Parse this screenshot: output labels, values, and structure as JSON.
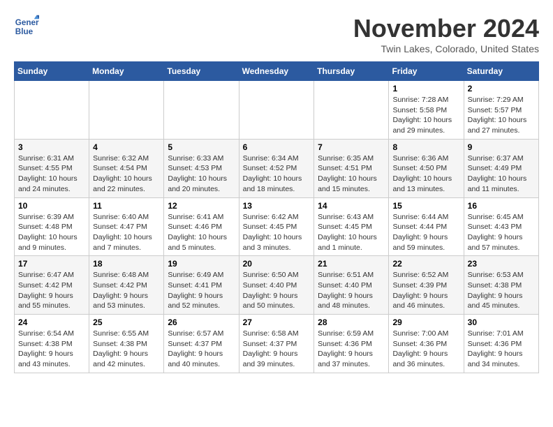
{
  "logo": {
    "line1": "General",
    "line2": "Blue"
  },
  "title": "November 2024",
  "location": "Twin Lakes, Colorado, United States",
  "weekdays": [
    "Sunday",
    "Monday",
    "Tuesday",
    "Wednesday",
    "Thursday",
    "Friday",
    "Saturday"
  ],
  "weeks": [
    [
      {
        "day": "",
        "info": ""
      },
      {
        "day": "",
        "info": ""
      },
      {
        "day": "",
        "info": ""
      },
      {
        "day": "",
        "info": ""
      },
      {
        "day": "",
        "info": ""
      },
      {
        "day": "1",
        "info": "Sunrise: 7:28 AM\nSunset: 5:58 PM\nDaylight: 10 hours and 29 minutes."
      },
      {
        "day": "2",
        "info": "Sunrise: 7:29 AM\nSunset: 5:57 PM\nDaylight: 10 hours and 27 minutes."
      }
    ],
    [
      {
        "day": "3",
        "info": "Sunrise: 6:31 AM\nSunset: 4:55 PM\nDaylight: 10 hours and 24 minutes."
      },
      {
        "day": "4",
        "info": "Sunrise: 6:32 AM\nSunset: 4:54 PM\nDaylight: 10 hours and 22 minutes."
      },
      {
        "day": "5",
        "info": "Sunrise: 6:33 AM\nSunset: 4:53 PM\nDaylight: 10 hours and 20 minutes."
      },
      {
        "day": "6",
        "info": "Sunrise: 6:34 AM\nSunset: 4:52 PM\nDaylight: 10 hours and 18 minutes."
      },
      {
        "day": "7",
        "info": "Sunrise: 6:35 AM\nSunset: 4:51 PM\nDaylight: 10 hours and 15 minutes."
      },
      {
        "day": "8",
        "info": "Sunrise: 6:36 AM\nSunset: 4:50 PM\nDaylight: 10 hours and 13 minutes."
      },
      {
        "day": "9",
        "info": "Sunrise: 6:37 AM\nSunset: 4:49 PM\nDaylight: 10 hours and 11 minutes."
      }
    ],
    [
      {
        "day": "10",
        "info": "Sunrise: 6:39 AM\nSunset: 4:48 PM\nDaylight: 10 hours and 9 minutes."
      },
      {
        "day": "11",
        "info": "Sunrise: 6:40 AM\nSunset: 4:47 PM\nDaylight: 10 hours and 7 minutes."
      },
      {
        "day": "12",
        "info": "Sunrise: 6:41 AM\nSunset: 4:46 PM\nDaylight: 10 hours and 5 minutes."
      },
      {
        "day": "13",
        "info": "Sunrise: 6:42 AM\nSunset: 4:45 PM\nDaylight: 10 hours and 3 minutes."
      },
      {
        "day": "14",
        "info": "Sunrise: 6:43 AM\nSunset: 4:45 PM\nDaylight: 10 hours and 1 minute."
      },
      {
        "day": "15",
        "info": "Sunrise: 6:44 AM\nSunset: 4:44 PM\nDaylight: 9 hours and 59 minutes."
      },
      {
        "day": "16",
        "info": "Sunrise: 6:45 AM\nSunset: 4:43 PM\nDaylight: 9 hours and 57 minutes."
      }
    ],
    [
      {
        "day": "17",
        "info": "Sunrise: 6:47 AM\nSunset: 4:42 PM\nDaylight: 9 hours and 55 minutes."
      },
      {
        "day": "18",
        "info": "Sunrise: 6:48 AM\nSunset: 4:42 PM\nDaylight: 9 hours and 53 minutes."
      },
      {
        "day": "19",
        "info": "Sunrise: 6:49 AM\nSunset: 4:41 PM\nDaylight: 9 hours and 52 minutes."
      },
      {
        "day": "20",
        "info": "Sunrise: 6:50 AM\nSunset: 4:40 PM\nDaylight: 9 hours and 50 minutes."
      },
      {
        "day": "21",
        "info": "Sunrise: 6:51 AM\nSunset: 4:40 PM\nDaylight: 9 hours and 48 minutes."
      },
      {
        "day": "22",
        "info": "Sunrise: 6:52 AM\nSunset: 4:39 PM\nDaylight: 9 hours and 46 minutes."
      },
      {
        "day": "23",
        "info": "Sunrise: 6:53 AM\nSunset: 4:38 PM\nDaylight: 9 hours and 45 minutes."
      }
    ],
    [
      {
        "day": "24",
        "info": "Sunrise: 6:54 AM\nSunset: 4:38 PM\nDaylight: 9 hours and 43 minutes."
      },
      {
        "day": "25",
        "info": "Sunrise: 6:55 AM\nSunset: 4:38 PM\nDaylight: 9 hours and 42 minutes."
      },
      {
        "day": "26",
        "info": "Sunrise: 6:57 AM\nSunset: 4:37 PM\nDaylight: 9 hours and 40 minutes."
      },
      {
        "day": "27",
        "info": "Sunrise: 6:58 AM\nSunset: 4:37 PM\nDaylight: 9 hours and 39 minutes."
      },
      {
        "day": "28",
        "info": "Sunrise: 6:59 AM\nSunset: 4:36 PM\nDaylight: 9 hours and 37 minutes."
      },
      {
        "day": "29",
        "info": "Sunrise: 7:00 AM\nSunset: 4:36 PM\nDaylight: 9 hours and 36 minutes."
      },
      {
        "day": "30",
        "info": "Sunrise: 7:01 AM\nSunset: 4:36 PM\nDaylight: 9 hours and 34 minutes."
      }
    ]
  ]
}
